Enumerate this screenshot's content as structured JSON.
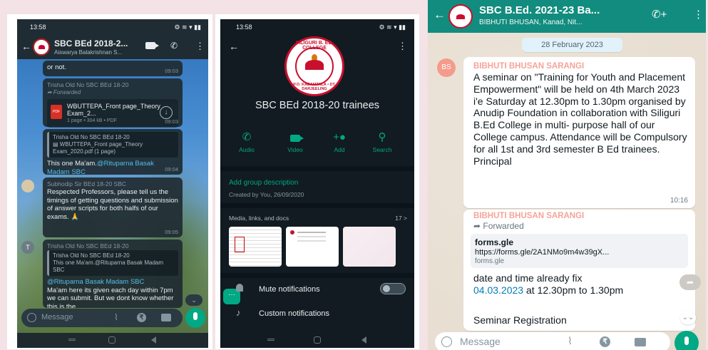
{
  "phone1": {
    "status_time": "13:58",
    "status_icons": "⚙ ≋ ▾ ▮▮",
    "chat_name": "SBC BEd 2018-2...",
    "chat_sub": "Aiswarya Balakrishnan S...",
    "messages": [
      {
        "text": "or not.",
        "time": "09:03"
      },
      {
        "sender": "Trisha Old No SBC BEd 18-20",
        "forwarded": "➦ Forwarded",
        "file_name": "WBUTTEPA_Front page_Theory Exam_2...",
        "file_meta": "1 page • 304 kB • PDF",
        "time": "09:03"
      },
      {
        "quote_sender": "Trisha Old No SBC BEd 18-20",
        "quote_text": "▤ WBUTTEPA_Front page_Theory Exam_2020.pdf (1 page)",
        "text": "This one Ma'am.",
        "mention": "@Rituparna Basak Madam SBC",
        "time": "09:04"
      },
      {
        "sender": "Subhodip Sir BEd 18-20 SBC",
        "text": "Respected Professors, please tell us the timings of getting questions and submission of answer scripts for both halfs of our exams. 🙏",
        "time": "09:05"
      },
      {
        "sender": "Trisha Old No SBC BEd 18-20",
        "quote_sender": "Trisha Old No SBC BEd 18-20",
        "quote_text": "This one Ma'am.@Rituparna Basak Madam SBC",
        "mention": "@Rituparna Basak Madam SBC",
        "text": "Ma'am here its given each day within 7pm we can submit. But we dont know whether this is the"
      }
    ],
    "avatar_t": "T",
    "composer_placeholder": "Message",
    "scroll_icon": "⌄"
  },
  "phone2": {
    "status_time": "13:58",
    "status_icons": "⚙ ≋ ▾ ▮▮",
    "logo_top": "SILIGURI B. ED. COLLEGE",
    "logo_bottom": "P.O. KADAMTALA • DT. DARJEELING",
    "group_title": "SBC BEd 2018-20 trainees",
    "actions": [
      "Audio",
      "Video",
      "Add",
      "Search"
    ],
    "add_description": "Add group description",
    "created_by": "Created by You, 26/09/2020",
    "media_header": "Media, links, and docs",
    "media_count": "17 >",
    "mute_label": "Mute notifications",
    "custom_label": "Custom notifications"
  },
  "phone3": {
    "chat_name": "SBC B.Ed. 2021-23 Ba...",
    "chat_sub": "BIBHUTI BHUSAN, Kanad, Nit...",
    "date_chip": "28 February 2023",
    "avatar_initials": "BS",
    "msg1": {
      "sender": "BIBHUTI BHUSAN SARANGI",
      "text": "A seminar on \"Training for Youth and Placement Empowerment\" will be held on 4th March 2023 i'e Saturday at 12.30pm to 1.30pm organised by Anudip Foundation in collaboration with Siliguri B.Ed College in multi- purpose hall of our College campus. Attendance will be Compulsory for all 1st and 3rd semester B Ed trainees.",
      "signature": "Principal",
      "time": "10:16"
    },
    "msg2": {
      "sender": "BIBHUTI BHUSAN SARANGI",
      "forwarded": "➦ Forwarded",
      "link_title": "forms.gle",
      "link_url": "https://forms.gle/2A1NMo9m4w39gX...",
      "link_domain": "forms.gle",
      "text_a": "date and time already fix",
      "link_date": "04.03.2023",
      "text_b": "at 12.30pm to 1.30pm",
      "text_c": "Seminar Registration"
    },
    "composer_placeholder": "Message",
    "scroll_icon": "⌄⌄",
    "share_icon": "➦"
  },
  "colors": {
    "whatsapp_green": "#00a884",
    "header_teal": "#128c7e",
    "dark_bg": "#111b21",
    "sender_pink": "#f6a39a",
    "mention_blue": "#53bdeb"
  }
}
